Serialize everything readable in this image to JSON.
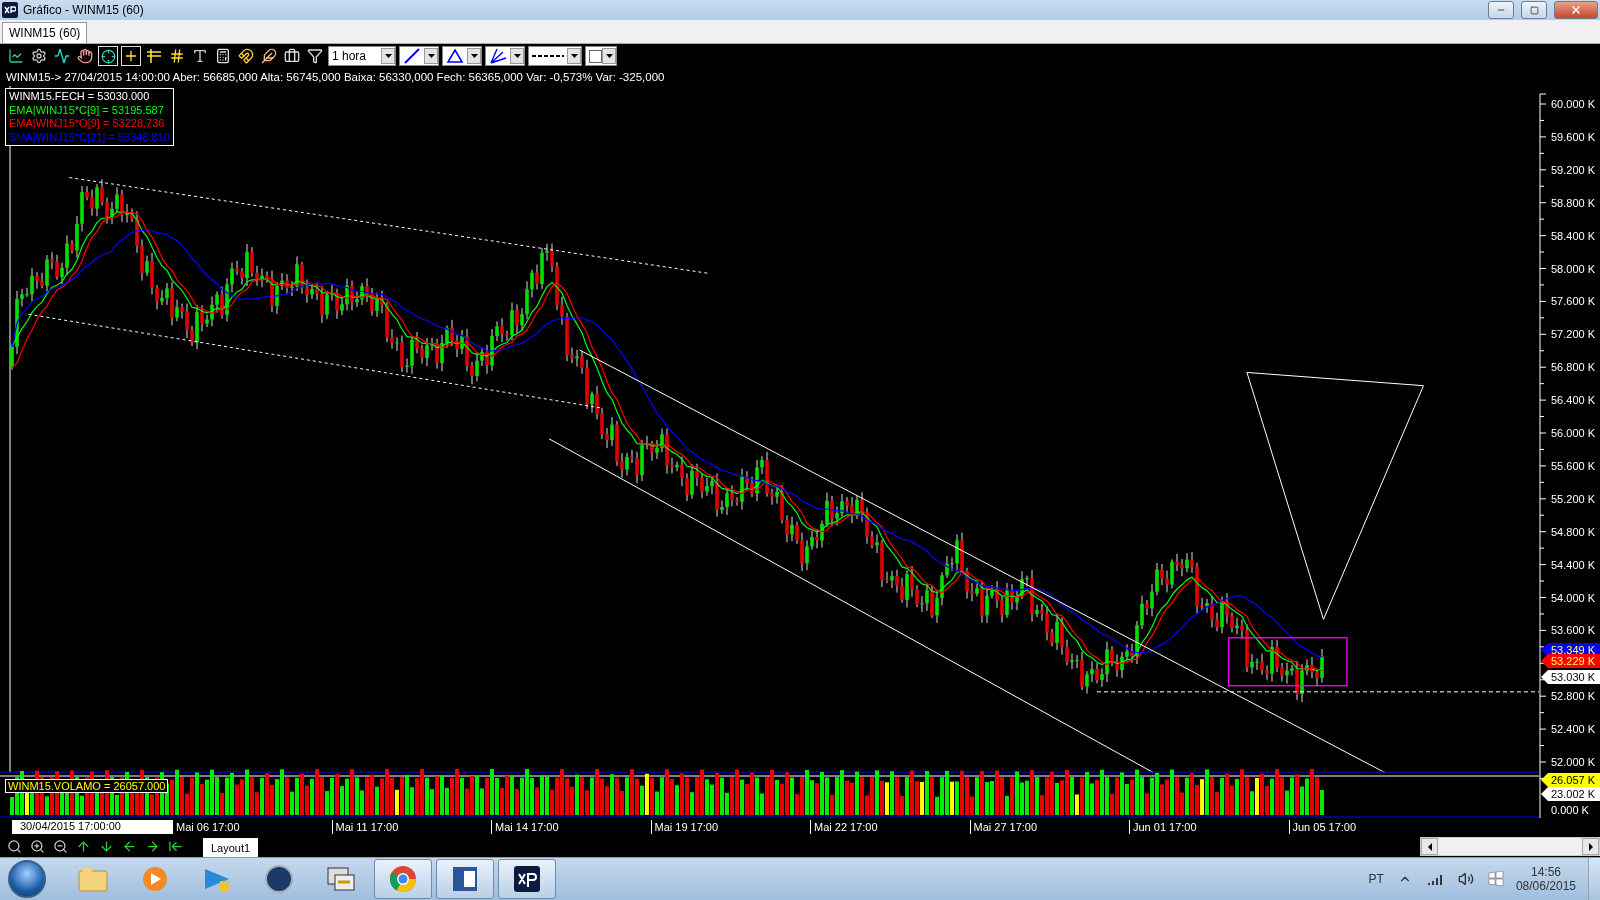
{
  "window": {
    "title": "Gráfico - WINM15 (60)"
  },
  "tabs": [
    {
      "label": "WINM15 (60)",
      "selected": true
    }
  ],
  "toolbar": {
    "interval": "1 hora"
  },
  "quote_line": "WINM15-> 27/04/2015 14:00:00 Aber: 56685,000 Alta: 56745,000 Baixa: 56330,000 Fech: 56365,000 Var: -0,573% Var: -325,000",
  "legend": [
    {
      "label": "WINM15.FECH = 53030.000",
      "color": "#ffffff",
      "kind": "price"
    },
    {
      "label": "EMA|WINJ15*C[9] = 53195.587",
      "color": "#00ff00",
      "kind": "ema"
    },
    {
      "label": "EMA|WINJ15*O[9] = 53228.736",
      "color": "#ff0000",
      "kind": "ema"
    },
    {
      "label": "SMA|WINJ15*C[21] = 53348.810",
      "color": "#0000ff",
      "kind": "sma"
    }
  ],
  "price_axis": {
    "ticks_upper": [
      "60.000 K",
      "59.600 K",
      "59.200 K",
      "58.800 K",
      "58.400 K",
      "58.000 K",
      "57.600 K",
      "57.200 K",
      "56.800 K",
      "56.400 K",
      "56.000 K",
      "55.600 K",
      "55.200 K",
      "54.800 K",
      "54.400 K",
      "54.000 K",
      "53.600 K"
    ],
    "ticks_lower": [
      "52.800 K",
      "52.400 K",
      "52.000 K"
    ]
  },
  "price_tags": [
    {
      "label": "53.349 K",
      "color": "#0000ff"
    },
    {
      "label": "53.229 K",
      "color": "#ff0000"
    },
    {
      "label": "53.030 K",
      "color": "#ffffff"
    }
  ],
  "volume": {
    "legend": "WINM15.VOLAMO = 26057.000",
    "tags": [
      {
        "label": "26.057 K",
        "color": "#ffff00"
      },
      {
        "label": "23.002 K",
        "color": "#ffffff"
      }
    ],
    "zero_label": "0.000 K"
  },
  "time_axis": {
    "cursor_label": "30/04/2015 17:00:00",
    "labels": [
      "Mai 06 17:00",
      "Mai 11 17:00",
      "Mai 14 17:00",
      "Mai 19 17:00",
      "Mai 22 17:00",
      "Mai 27 17:00",
      "Jun 01 17:00",
      "Jun 05 17:00"
    ]
  },
  "layout_tab": "Layout1",
  "taskbar": {
    "language": "PT",
    "time": "14:56",
    "date": "08/06/2015"
  }
}
